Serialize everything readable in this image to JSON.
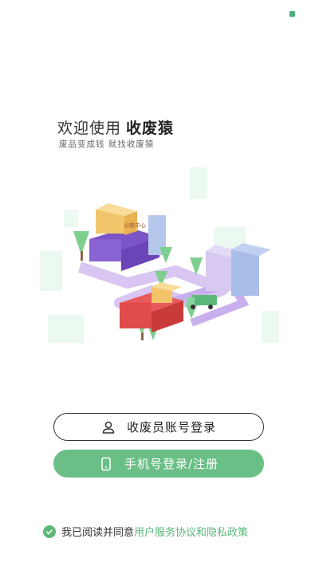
{
  "welcome": {
    "prefix": "欢迎使用",
    "brand": "收废猿"
  },
  "slogan": "废品变成钱 就找收废猿",
  "illustration": {
    "sign_text": "分拣中心"
  },
  "buttons": {
    "account_login": "收废员账号登录",
    "phone_login": "手机号登录/注册"
  },
  "agreement": {
    "prefix": "我已阅读并同意",
    "link": "用户服务协议和隐私政策"
  },
  "colors": {
    "accent": "#5cb87a",
    "button_green": "#6abf86",
    "purple": "#8a63d2"
  }
}
